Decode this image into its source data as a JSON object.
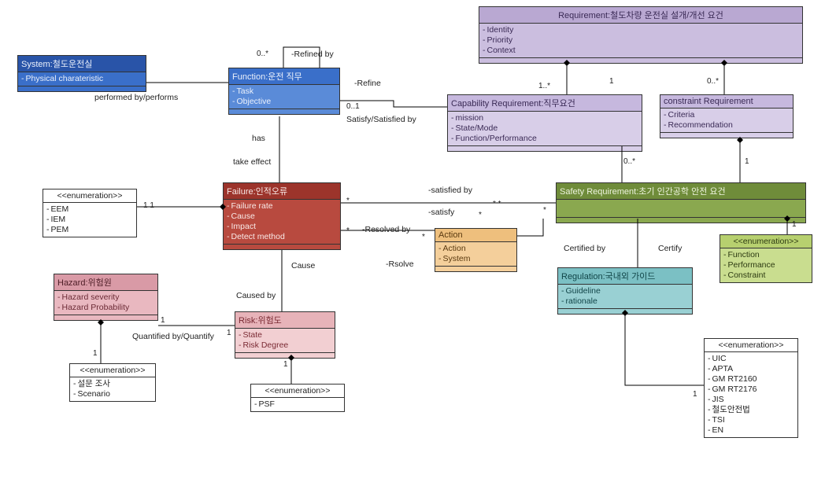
{
  "boxes": {
    "system": {
      "title": "System:철도운전실",
      "attrs": [
        "Physical charateristic"
      ]
    },
    "function": {
      "title": "Function:운전 직무",
      "attrs": [
        "Task",
        "Objective"
      ]
    },
    "requirement": {
      "title": "Requirement:철도차량 운전실 설개/개선 요건",
      "attrs": [
        "Identity",
        "Priority",
        "Context"
      ]
    },
    "capability": {
      "title": "Capability Requirement:직무요건",
      "attrs": [
        "mission",
        "State/Mode",
        "Function/Performance"
      ]
    },
    "constraint": {
      "title": "constraint Requirement",
      "attrs": [
        "Criteria",
        "Recommendation"
      ]
    },
    "failure": {
      "title": "Failure:인적오류",
      "attrs": [
        "Failure rate",
        "Cause",
        "Impact",
        "Detect method"
      ]
    },
    "action": {
      "title": "Action",
      "attrs": [
        "Action",
        "System"
      ]
    },
    "safety": {
      "title": "Safety Requirement:초기 인간공학 안전 요건",
      "attrs": []
    },
    "regulation": {
      "title": "Regulation:국내외 가이드",
      "attrs": [
        "Guideline",
        "rationale"
      ]
    },
    "hazard": {
      "title": "Hazard:위험원",
      "attrs": [
        "Hazard severity",
        "Hazard Probability"
      ]
    },
    "risk": {
      "title": "Risk:위험도",
      "attrs": [
        "State",
        "Risk Degree"
      ]
    },
    "enum_eem": {
      "stereo": "<<enumeration>>",
      "attrs": [
        "EEM",
        "IEM",
        "PEM"
      ]
    },
    "enum_haz": {
      "stereo": "<<enumeration>>",
      "attrs": [
        "설문 조사",
        "Scenario"
      ]
    },
    "enum_psf": {
      "stereo": "<<enumeration>>",
      "attrs": [
        "PSF"
      ]
    },
    "enum_fpc": {
      "stereo": "<<enumeration>>",
      "attrs": [
        "Function",
        "Performance",
        "Constraint"
      ]
    },
    "enum_std": {
      "stereo": "<<enumeration>>",
      "attrs": [
        "UIC",
        "APTA",
        "GM RT2160",
        "GM RT2176",
        "JIS",
        "철도안전법",
        "TSI",
        "EN"
      ]
    }
  },
  "labels": {
    "performed": "performed by/performs",
    "refined": "-Refined by",
    "refine": "-Refine",
    "satisfy": "Satisfy/Satisfied by",
    "has": "has",
    "take": "take effect",
    "cause": "Cause",
    "caused": "Caused by",
    "quantify": "Quantified by/Quantify",
    "resolved": "-Resolved by",
    "resolve": "-Rsolve",
    "satby": "-satisfied by",
    "sat": "-satisfy",
    "certby": "Certified by",
    "cert": "Certify",
    "m_0s": "0..*",
    "m_01": "0..1",
    "m_1s": "1..*",
    "m_1": "1",
    "m_11": "1  1",
    "m_s": "*",
    "m_ss": "*  *"
  }
}
